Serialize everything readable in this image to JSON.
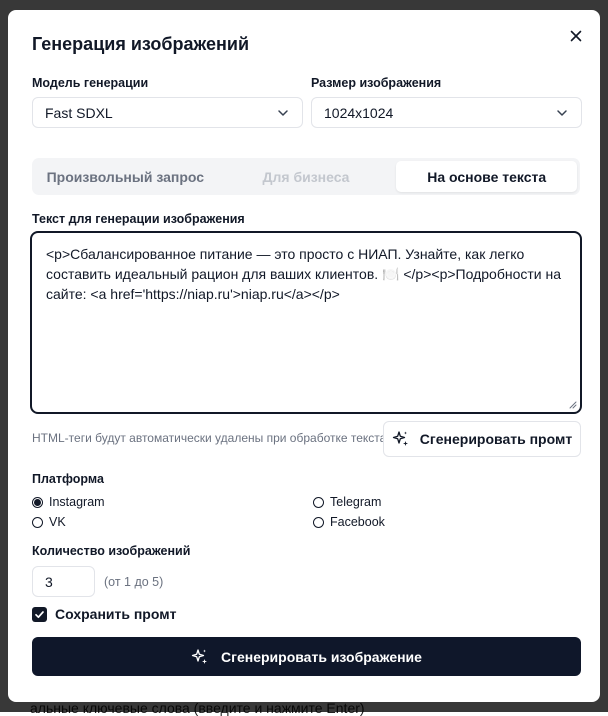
{
  "modal": {
    "title": "Генерация изображений",
    "model": {
      "label": "Модель генерации",
      "value": "Fast SDXL"
    },
    "size": {
      "label": "Размер изображения",
      "value": "1024x1024"
    },
    "tabs": [
      {
        "label": "Произвольный запрос",
        "state": "normal"
      },
      {
        "label": "Для бизнеса",
        "state": "disabled"
      },
      {
        "label": "На основе текста",
        "state": "active"
      }
    ],
    "text": {
      "label": "Текст для генерации изображения",
      "value": "<p>Сбалансированное питание — это просто с НИАП. Узнайте, как легко составить идеальный рацион для ваших клиентов. 🍽️ </p><p>Подробности на сайте: <a href='https://niap.ru'>niap.ru</a></p>"
    },
    "hint": "HTML-теги будут автоматически удалены при обработке текста",
    "generate_prompt_label": "Сгенерировать промт",
    "platform": {
      "label": "Платформа",
      "options": [
        {
          "label": "Instagram",
          "selected": true
        },
        {
          "label": "Telegram",
          "selected": false
        },
        {
          "label": "VK",
          "selected": false
        },
        {
          "label": "Facebook",
          "selected": false
        }
      ]
    },
    "quantity": {
      "label": "Количество изображений",
      "value": "3",
      "hint": "(от 1 до 5)"
    },
    "save_prompt": {
      "label": "Сохранить промт",
      "checked": true
    },
    "generate_image_label": "Сгенерировать изображение"
  },
  "background": {
    "bottom_text": "альные ключевые слова (введите и нажмите Enter)"
  },
  "colors": {
    "primary": "#0f172a",
    "border": "#e2e4e9",
    "muted": "#6b7280",
    "tab_bg": "#f3f4f6"
  },
  "icons": [
    "close-icon",
    "chevron-down-icon",
    "sparkles-icon",
    "check-icon",
    "resize-grip-icon"
  ]
}
